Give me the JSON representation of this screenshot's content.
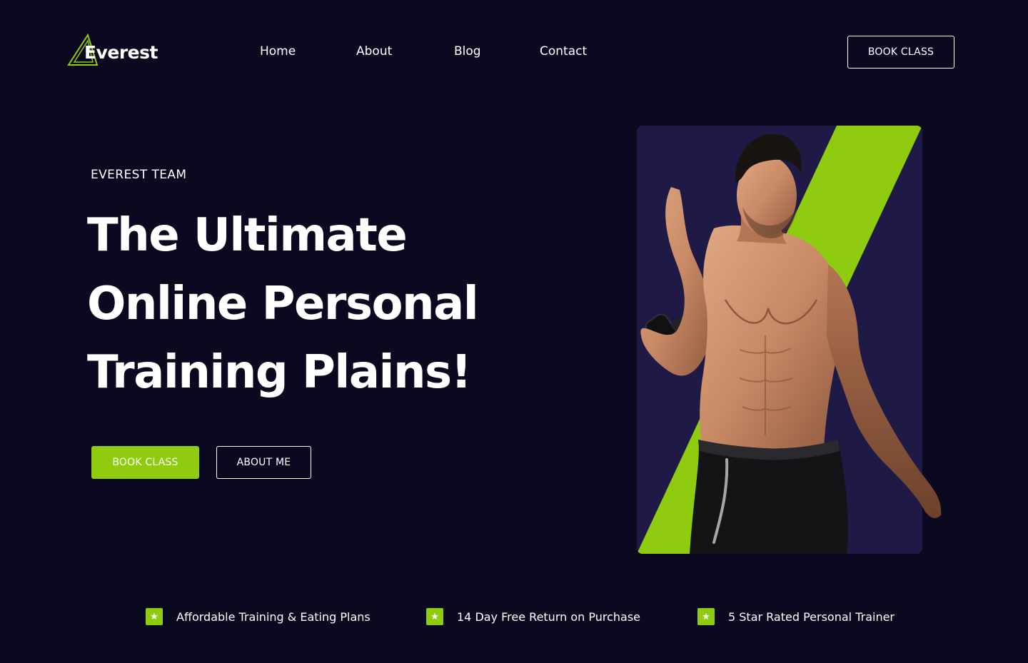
{
  "brand": {
    "name": "Everest",
    "accent_color": "#8fcb0e",
    "background_color": "#0b0920",
    "panel_color": "#1e1a45",
    "logo_icon": "triangle-mountain-icon"
  },
  "nav": {
    "items": [
      {
        "label": "Home"
      },
      {
        "label": "About"
      },
      {
        "label": "Blog"
      },
      {
        "label": "Contact"
      }
    ],
    "cta_label": "BOOK CLASS"
  },
  "hero": {
    "eyebrow": "EVEREST TEAM",
    "title_lines": [
      "The Ultimate",
      "Online Personal",
      "Training Plains!"
    ],
    "primary_button": "BOOK CLASS",
    "secondary_button": "ABOUT ME",
    "image_subject": "fitness-trainer-with-dumbbell"
  },
  "features": [
    {
      "icon": "star-icon",
      "text": "Affordable Training & Eating Plans"
    },
    {
      "icon": "star-icon",
      "text": "14 Day Free Return on Purchase"
    },
    {
      "icon": "star-icon",
      "text": "5 Star Rated Personal Trainer"
    }
  ]
}
